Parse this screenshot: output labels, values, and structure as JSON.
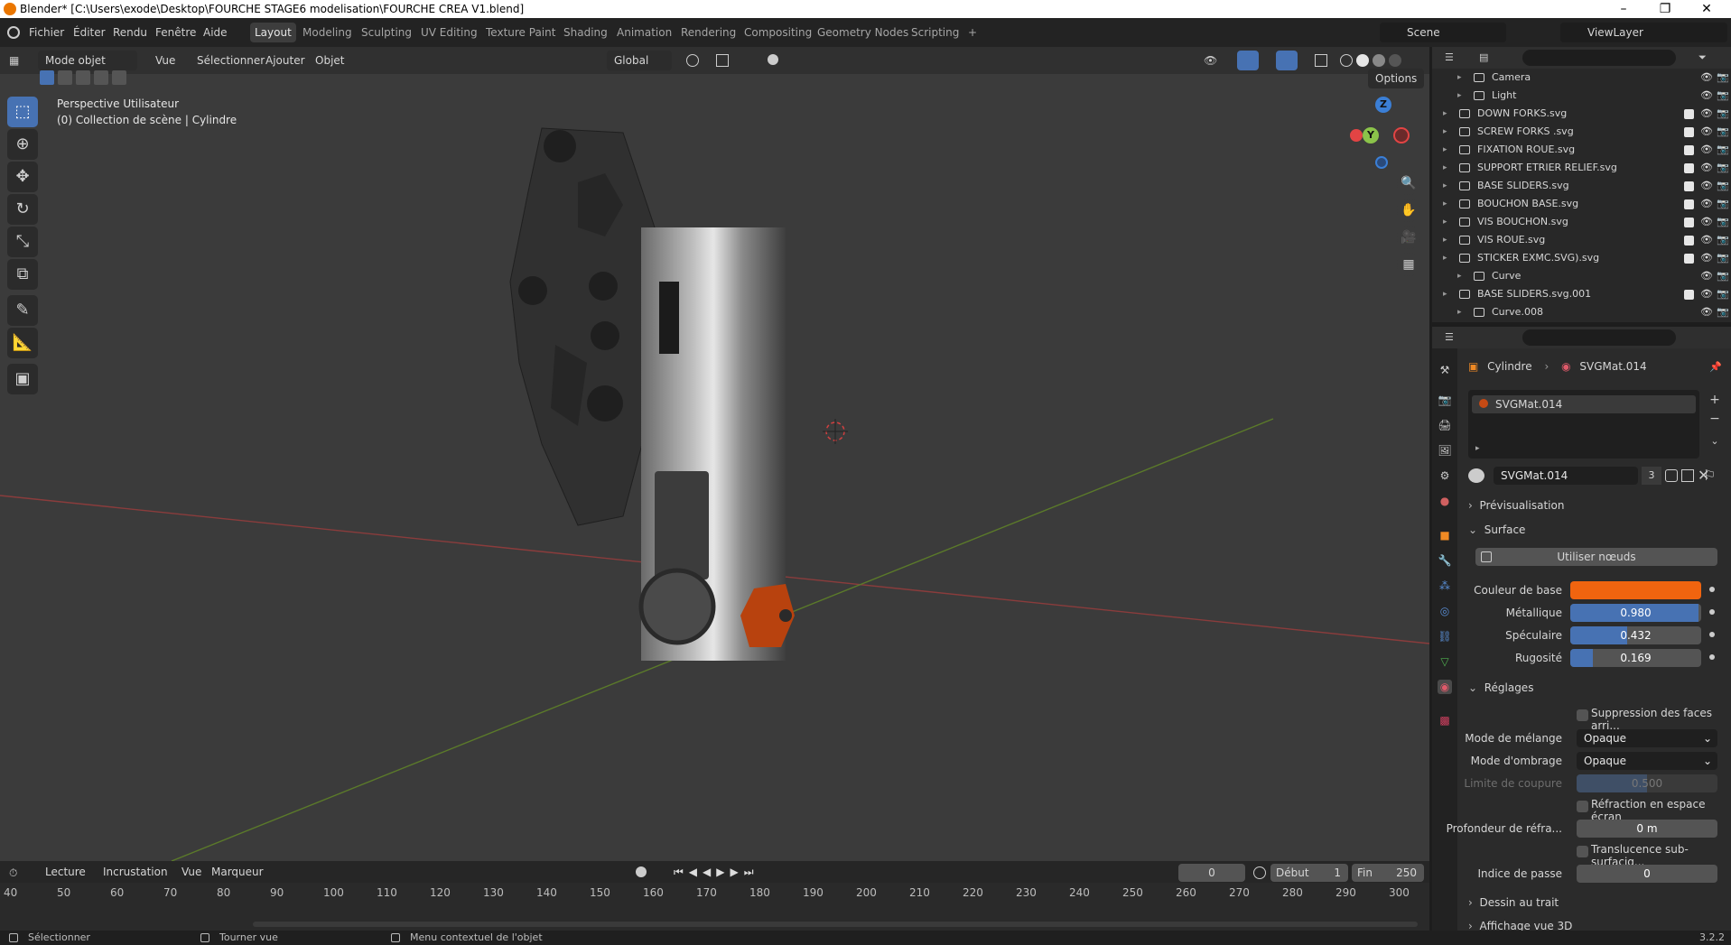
{
  "window": {
    "title": "Blender* [C:\\Users\\exode\\Desktop\\FOURCHE STAGE6 modelisation\\FOURCHE CREA V1.blend]",
    "controls": [
      "–",
      "❐",
      "✕"
    ]
  },
  "menubar": {
    "items": [
      "Fichier",
      "Éditer",
      "Rendu",
      "Fenêtre",
      "Aide"
    ],
    "workspaces": [
      "Layout",
      "Modeling",
      "Sculpting",
      "UV Editing",
      "Texture Paint",
      "Shading",
      "Animation",
      "Rendering",
      "Compositing",
      "Geometry Nodes",
      "Scripting",
      "+"
    ],
    "active_workspace": "Layout",
    "scene": "Scene",
    "viewlayer": "ViewLayer"
  },
  "viewport_header": {
    "mode": "Mode objet",
    "menus": [
      "Vue",
      "Sélectionner",
      "Ajouter",
      "Objet"
    ],
    "transform": "Global",
    "options": "Options"
  },
  "viewport": {
    "overlay_line1": "Perspective Utilisateur",
    "overlay_line2": "(0) Collection de scène | Cylindre",
    "gizmo": {
      "z": "Z",
      "y": "Y",
      "x": "X"
    }
  },
  "timeline": {
    "menus": [
      "Lecture",
      "Incrustation",
      "Vue",
      "Marqueur"
    ],
    "current_frame": "0",
    "start_label": "Début",
    "start": "1",
    "end_label": "Fin",
    "end": "250",
    "ticks": [
      "40",
      "50",
      "60",
      "70",
      "80",
      "90",
      "100",
      "110",
      "120",
      "130",
      "140",
      "150",
      "160",
      "170",
      "180",
      "190",
      "200",
      "210",
      "220",
      "230",
      "240",
      "250",
      "260",
      "270",
      "280",
      "290",
      "300"
    ]
  },
  "statusbar": {
    "select": "Sélectionner",
    "rotate": "Tourner vue",
    "context": "Menu contextuel de l'objet",
    "version": "3.2.2"
  },
  "outliner": {
    "items": [
      {
        "name": "Camera",
        "child": true
      },
      {
        "name": "Light",
        "child": true
      },
      {
        "name": "DOWN FORKS.svg",
        "child": false
      },
      {
        "name": "SCREW FORKS .svg",
        "child": false
      },
      {
        "name": "FIXATION ROUE.svg",
        "child": false
      },
      {
        "name": "SUPPORT ETRIER RELIEF.svg",
        "child": false
      },
      {
        "name": "BASE SLIDERS.svg",
        "child": false
      },
      {
        "name": "BOUCHON BASE.svg",
        "child": false
      },
      {
        "name": "VIS BOUCHON.svg",
        "child": false
      },
      {
        "name": "VIS ROUE.svg",
        "child": false
      },
      {
        "name": "STICKER EXMC.SVG).svg",
        "child": false
      },
      {
        "name": "Curve",
        "child": true
      },
      {
        "name": "BASE SLIDERS.svg.001",
        "child": false
      },
      {
        "name": "Curve.008",
        "child": true
      }
    ]
  },
  "properties": {
    "breadcrumb_object": "Cylindre",
    "breadcrumb_material": "SVGMat.014",
    "slot": "SVGMat.014",
    "material_name": "SVGMat.014",
    "users": "3",
    "sections": {
      "preview": "Prévisualisation",
      "surface": "Surface",
      "use_nodes": "Utiliser nœuds",
      "settings": "Réglages",
      "lineart": "Dessin au trait",
      "viewport": "Affichage vue 3D"
    },
    "fields": {
      "base_color_label": "Couleur de base",
      "base_color": "#f0640f",
      "metallic_label": "Métallique",
      "metallic": "0.980",
      "specular_label": "Spéculaire",
      "specular": "0.432",
      "roughness_label": "Rugosité",
      "roughness": "0.169",
      "backface_label": "Suppression des faces arri...",
      "blend_label": "Mode de mélange",
      "blend": "Opaque",
      "shadow_label": "Mode d'ombrage",
      "shadow": "Opaque",
      "clip_label": "Limite de coupure",
      "clip": "0.500",
      "refraction_label": "Réfraction en espace écran",
      "depth_label": "Profondeur de réfra...",
      "depth": "0 m",
      "sss_label": "Translucence sub-surfaciq...",
      "pass_label": "Indice de passe",
      "pass": "0"
    }
  }
}
